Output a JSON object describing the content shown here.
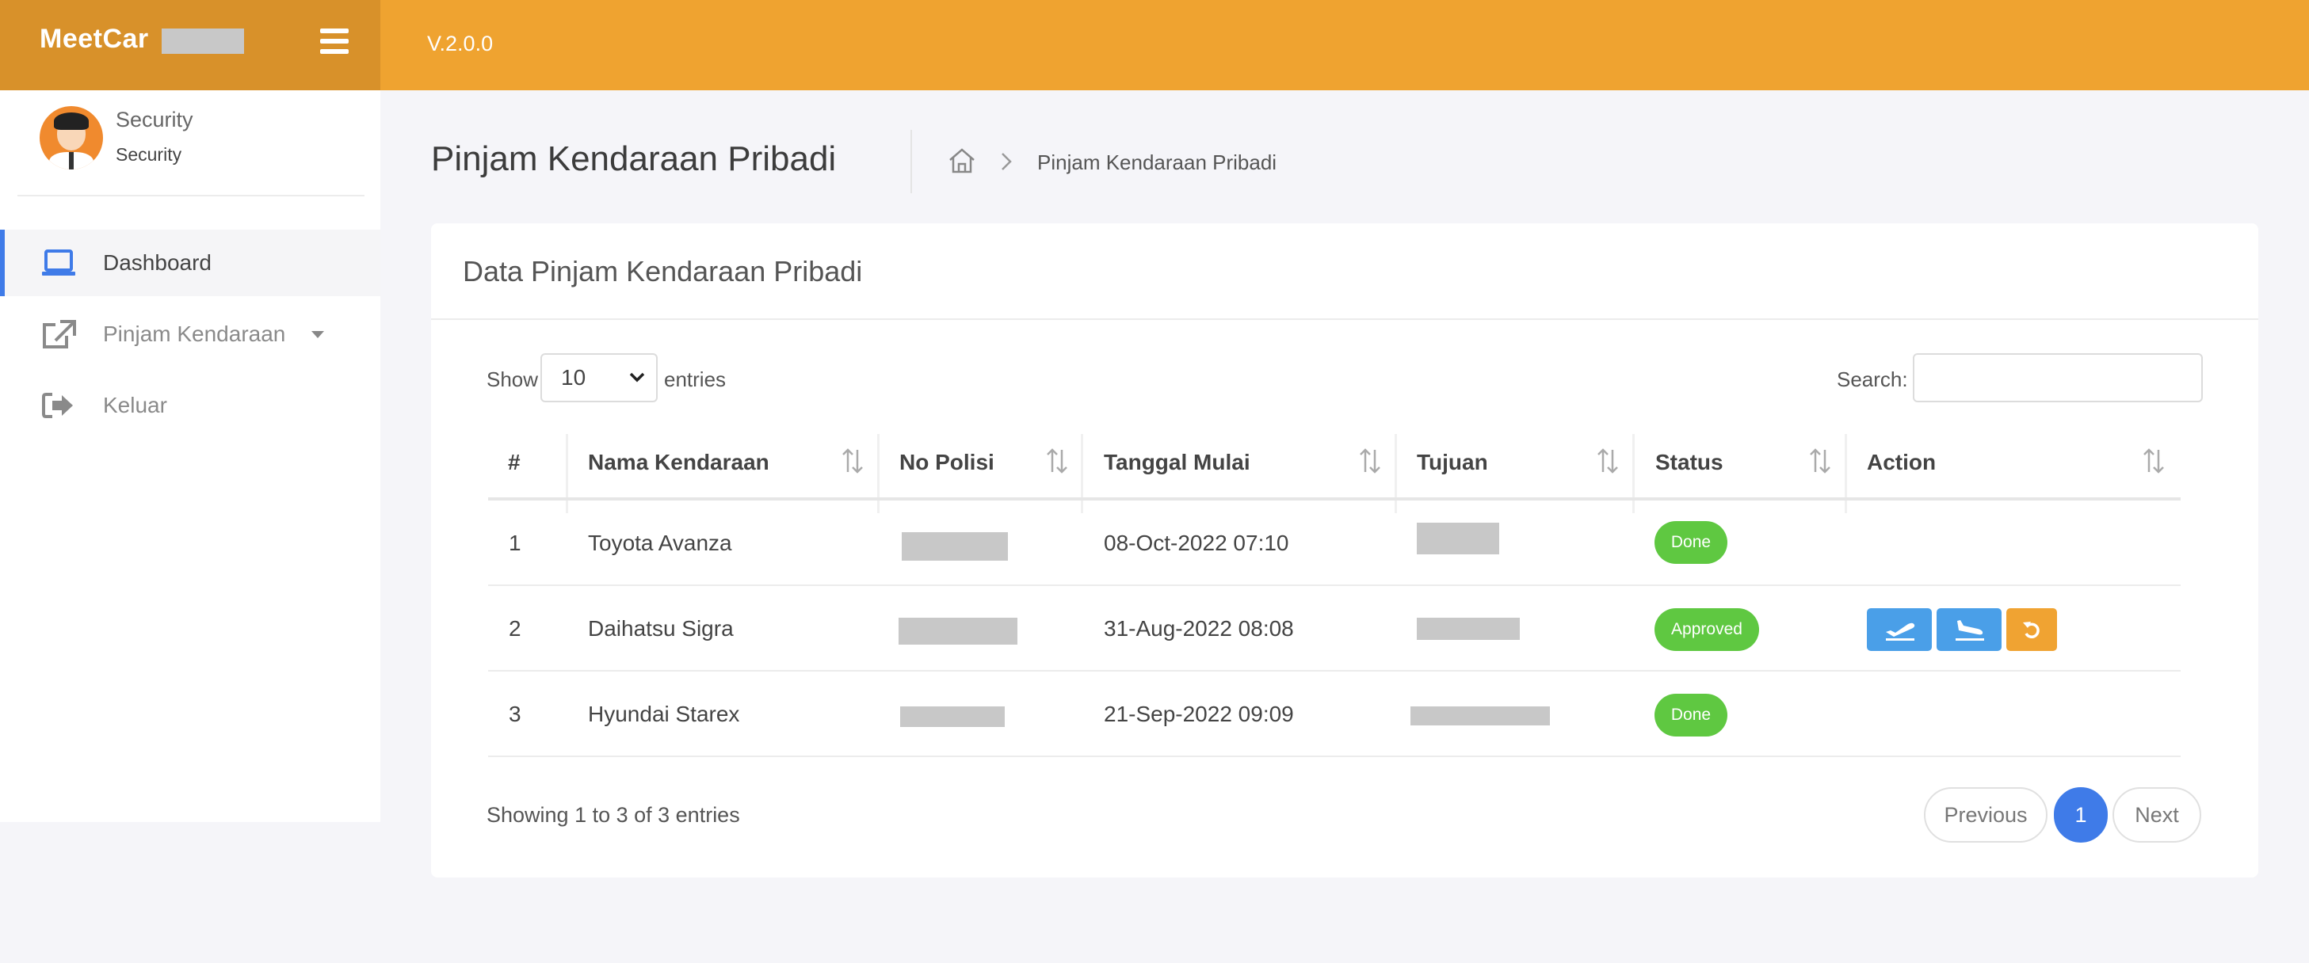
{
  "header": {
    "brand": "MeetCar",
    "version": "V.2.0.0"
  },
  "profile": {
    "role": "Security",
    "subtitle": "Security"
  },
  "sidebar": {
    "items": [
      {
        "label": "Dashboard",
        "icon": "laptop-icon"
      },
      {
        "label": "Pinjam Kendaraan",
        "icon": "external-link-icon"
      },
      {
        "label": "Keluar",
        "icon": "sign-out-icon"
      }
    ]
  },
  "page": {
    "title": "Pinjam Kendaraan Pribadi",
    "breadcrumb_current": "Pinjam Kendaraan Pribadi"
  },
  "card": {
    "title": "Data Pinjam Kendaraan Pribadi",
    "show_label": "Show",
    "entries_value": "10",
    "entries_label": "entries",
    "search_label": "Search:",
    "search_value": ""
  },
  "table": {
    "columns": [
      "#",
      "Nama Kendaraan",
      "No Polisi",
      "Tanggal Mulai",
      "Tujuan",
      "Status",
      "Action"
    ],
    "rows": [
      {
        "no": "1",
        "name": "Toyota Avanza",
        "date": "08-Oct-2022 07:10",
        "status": "Done",
        "actions": []
      },
      {
        "no": "2",
        "name": "Daihatsu Sigra",
        "date": "31-Aug-2022 08:08",
        "status": "Approved",
        "actions": [
          "departure-icon",
          "arrival-icon",
          "undo-icon"
        ]
      },
      {
        "no": "3",
        "name": "Hyundai Starex",
        "date": "21-Sep-2022 09:09",
        "status": "Done",
        "actions": []
      }
    ]
  },
  "footer": {
    "info": "Showing 1 to 3 of 3 entries",
    "previous": "Previous",
    "page": "1",
    "next": "Next"
  },
  "colors": {
    "header": "#efa330",
    "brand_bg": "#d8912a",
    "accent": "#3f7be8",
    "status_green": "#5fc841",
    "action_blue": "#4a9fe8",
    "action_orange": "#f0a332"
  }
}
